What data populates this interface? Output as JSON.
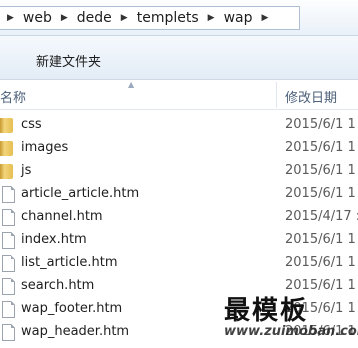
{
  "breadcrumb": {
    "parts": [
      "web",
      "dede",
      "templets",
      "wap"
    ]
  },
  "toolbar": {
    "new_folder_label": "新建文件夹"
  },
  "columns": {
    "name_header": "名称",
    "date_header": "修改日期"
  },
  "files": [
    {
      "name": "css",
      "type": "folder",
      "date": "2015/6/1 1"
    },
    {
      "name": "images",
      "type": "folder",
      "date": "2015/6/1 1"
    },
    {
      "name": "js",
      "type": "folder",
      "date": "2015/6/1 1"
    },
    {
      "name": "article_article.htm",
      "type": "file",
      "date": "2015/6/1 1"
    },
    {
      "name": "channel.htm",
      "type": "file",
      "date": "2015/4/17 :"
    },
    {
      "name": "index.htm",
      "type": "file",
      "date": "2015/6/1 1"
    },
    {
      "name": "list_article.htm",
      "type": "file",
      "date": "2015/6/1 1"
    },
    {
      "name": "search.htm",
      "type": "file",
      "date": "2015/6/1 1"
    },
    {
      "name": "wap_footer.htm",
      "type": "file",
      "date": "2015/6/1 1"
    },
    {
      "name": "wap_header.htm",
      "type": "file",
      "date": "2015/6/1 1"
    }
  ],
  "watermark": {
    "title": "最模板",
    "url": "www.zuimoban.com"
  }
}
